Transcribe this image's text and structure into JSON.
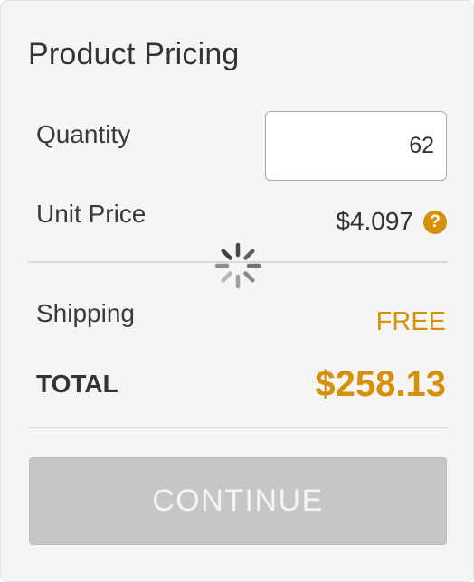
{
  "title": "Product Pricing",
  "quantity": {
    "label": "Quantity",
    "value": "62"
  },
  "unit_price": {
    "label": "Unit Price",
    "value": "$4.097",
    "help_icon": "question-circle-icon",
    "help_glyph": "?"
  },
  "loading_icon": "spinner-icon",
  "shipping": {
    "label": "Shipping",
    "value": "FREE"
  },
  "total": {
    "label": "TOTAL",
    "value": "$258.13"
  },
  "continue_button": {
    "label": "CONTINUE",
    "enabled": false
  },
  "colors": {
    "accent": "#d6900a",
    "text": "#333333",
    "panel_background": "#f5f5f5",
    "button_disabled": "#c6c6c6"
  }
}
